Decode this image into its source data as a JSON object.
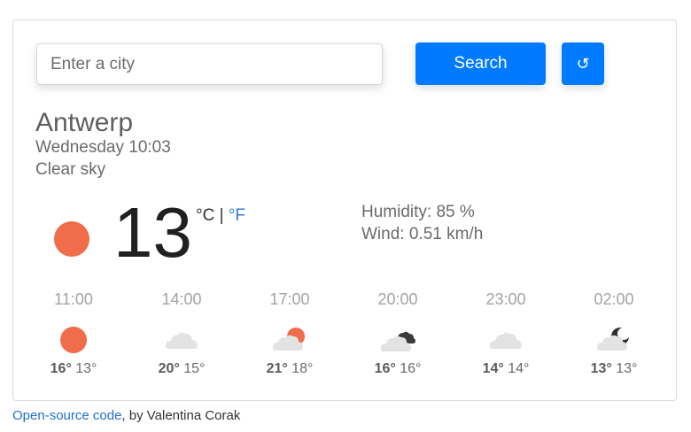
{
  "search": {
    "placeholder": "Enter a city",
    "value": "",
    "button_label": "Search",
    "location_icon": "refresh-icon"
  },
  "current": {
    "city": "Antwerp",
    "datetime": "Wednesday 10:03",
    "description": "Clear sky",
    "icon": "sun-icon",
    "temperature": "13",
    "unit_c": "°C",
    "separator": " | ",
    "unit_f": "°F",
    "humidity": "Humidity: 85 %",
    "wind": "Wind: 0.51 km/h"
  },
  "forecast": [
    {
      "time": "11:00",
      "icon": "sun-icon",
      "max": "16°",
      "min": "13°"
    },
    {
      "time": "14:00",
      "icon": "cloud-icon",
      "max": "20°",
      "min": "15°"
    },
    {
      "time": "17:00",
      "icon": "partly-sunny-icon",
      "max": "21°",
      "min": "18°"
    },
    {
      "time": "20:00",
      "icon": "dark-clouds-icon",
      "max": "16°",
      "min": "16°"
    },
    {
      "time": "23:00",
      "icon": "cloud-icon",
      "max": "14°",
      "min": "14°"
    },
    {
      "time": "02:00",
      "icon": "partly-cloudy-night-icon",
      "max": "13°",
      "min": "13°"
    }
  ],
  "colors": {
    "accent": "#007bff",
    "sun": "#ef6d4b",
    "link": "#1f6fd0"
  },
  "footer": {
    "link_text": "Open-source code",
    "suffix": ", by Valentina Corak"
  }
}
